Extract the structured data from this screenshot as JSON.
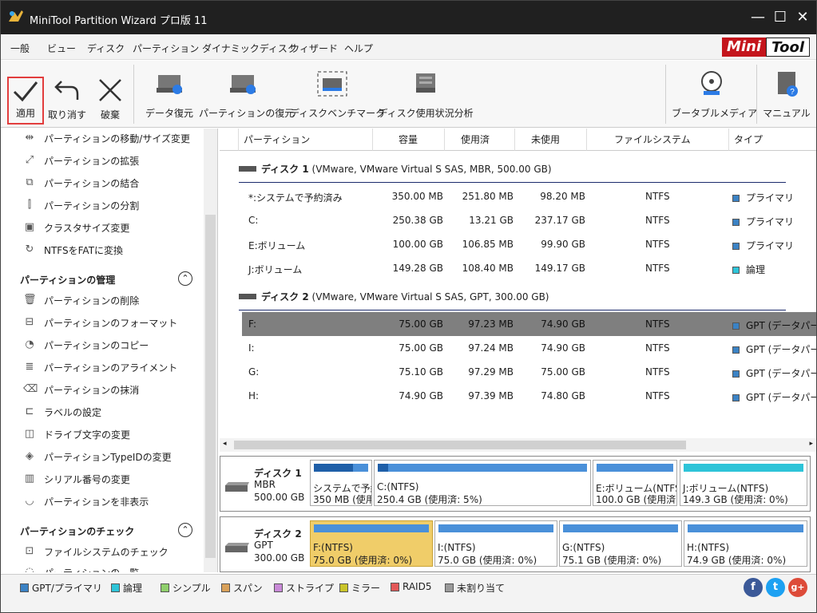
{
  "window": {
    "title": "MiniTool Partition Wizard プロ版 11",
    "btn_min": "—",
    "btn_max": "☐",
    "btn_close": "✕"
  },
  "menu": {
    "items": [
      "一般",
      "ビュー",
      "ディスク",
      "パーティション",
      "ダイナミックディスク",
      "ウィザード",
      "ヘルプ"
    ],
    "brand1": "Mini",
    "brand2": "Tool"
  },
  "toolbar": {
    "apply": "適用",
    "undo": "取り消す",
    "discard": "破棄",
    "data_recovery": "データ復元",
    "partition_recovery": "パーティションの復元",
    "disk_benchmark": "ディスクベンチマーク",
    "space_analyzer": "ディスク使用状況分析",
    "bootable_media": "ブータブルメディア",
    "manual": "マニュアル"
  },
  "sidebar": {
    "top_items": [
      "パーティションの移動/サイズ変更",
      "パーティションの拡張",
      "パーティションの結合",
      "パーティションの分割",
      "クラスタサイズ変更",
      "NTFSをFATに変換"
    ],
    "manage_title": "パーティションの管理",
    "manage_items": [
      "パーティションの削除",
      "パーティションのフォーマット",
      "パーティションのコピー",
      "パーティションのアライメント",
      "パーティションの抹消",
      "ラベルの設定",
      "ドライブ文字の変更",
      "パーティションTypeIDの変更",
      "シリアル番号の変更",
      "パーティションを非表示"
    ],
    "check_title": "パーティションのチェック",
    "check_items": [
      "ファイルシステムのチェック",
      "パーティションの一覧"
    ]
  },
  "table": {
    "headers": [
      "パーティション",
      "容量",
      "使用済",
      "未使用",
      "ファイルシステム",
      "タイプ"
    ],
    "disk1_label": "ディスク 1",
    "disk1_desc": "(VMware, VMware Virtual S SAS, MBR, 500.00 GB)",
    "disk1_rows": [
      [
        "*:システムで予約済み",
        "350.00 MB",
        "251.80 MB",
        "98.20 MB",
        "NTFS",
        "プライマリ"
      ],
      [
        "C:",
        "250.38 GB",
        "13.21 GB",
        "237.17 GB",
        "NTFS",
        "プライマリ"
      ],
      [
        "E:ボリューム",
        "100.00 GB",
        "106.85 MB",
        "99.90 GB",
        "NTFS",
        "プライマリ"
      ],
      [
        "J:ボリューム",
        "149.28 GB",
        "108.40 MB",
        "149.17 GB",
        "NTFS",
        "論理"
      ]
    ],
    "disk2_label": "ディスク 2",
    "disk2_desc": "(VMware, VMware Virtual S SAS, GPT, 300.00 GB)",
    "disk2_rows": [
      [
        "F:",
        "75.00 GB",
        "97.23 MB",
        "74.90 GB",
        "NTFS",
        "GPT (データパー"
      ],
      [
        "I:",
        "75.00 GB",
        "97.24 MB",
        "74.90 GB",
        "NTFS",
        "GPT (データパー"
      ],
      [
        "G:",
        "75.10 GB",
        "97.29 MB",
        "75.00 GB",
        "NTFS",
        "GPT (データパー"
      ],
      [
        "H:",
        "74.90 GB",
        "97.39 MB",
        "74.80 GB",
        "NTFS",
        "GPT (データパー"
      ]
    ]
  },
  "diskmap": {
    "disk1": {
      "name": "ディスク 1",
      "type": "MBR",
      "size": "500.00 GB",
      "parts": [
        {
          "l1": "システムで予約",
          "l2": "350 MB (使用",
          "used_fraction": 0.72
        },
        {
          "l1": "C:(NTFS)",
          "l2": "250.4 GB (使用済: 5%)",
          "used_fraction": 0.05
        },
        {
          "l1": "E:ボリューム(NTFS)",
          "l2": "100.0 GB (使用済",
          "used_fraction": 0.0
        },
        {
          "l1": "J:ボリューム(NTFS)",
          "l2": "149.3 GB (使用済: 0%)",
          "used_fraction": 0.0
        }
      ]
    },
    "disk2": {
      "name": "ディスク 2",
      "type": "GPT",
      "size": "300.00 GB",
      "parts": [
        {
          "l1": "F:(NTFS)",
          "l2": "75.0 GB (使用済: 0%)",
          "used_fraction": 0.0
        },
        {
          "l1": "I:(NTFS)",
          "l2": "75.0 GB (使用済: 0%)",
          "used_fraction": 0.0
        },
        {
          "l1": "G:(NTFS)",
          "l2": "75.1 GB (使用済: 0%)",
          "used_fraction": 0.0
        },
        {
          "l1": "H:(NTFS)",
          "l2": "74.9 GB (使用済: 0%)",
          "used_fraction": 0.0
        }
      ]
    }
  },
  "legend": [
    {
      "label": "GPT/プライマリ",
      "color": "#3b82c4"
    },
    {
      "label": "論理",
      "color": "#2ec4d8"
    },
    {
      "label": "シンプル",
      "color": "#8fcf6c"
    },
    {
      "label": "スパン",
      "color": "#d9a15a"
    },
    {
      "label": "ストライプ",
      "color": "#c98ad8"
    },
    {
      "label": "ミラー",
      "color": "#c9c42a"
    },
    {
      "label": "RAID5",
      "color": "#e25858"
    },
    {
      "label": "未割り当て",
      "color": "#9a9a9a"
    }
  ],
  "social": {
    "facebook": "f",
    "twitter": "t",
    "gplus": "g+"
  },
  "colors": {
    "primary": "#3b82c4",
    "logical": "#2ec4d8",
    "selected_row": "#7f7f7f",
    "selected_part": "#f0cd69"
  }
}
